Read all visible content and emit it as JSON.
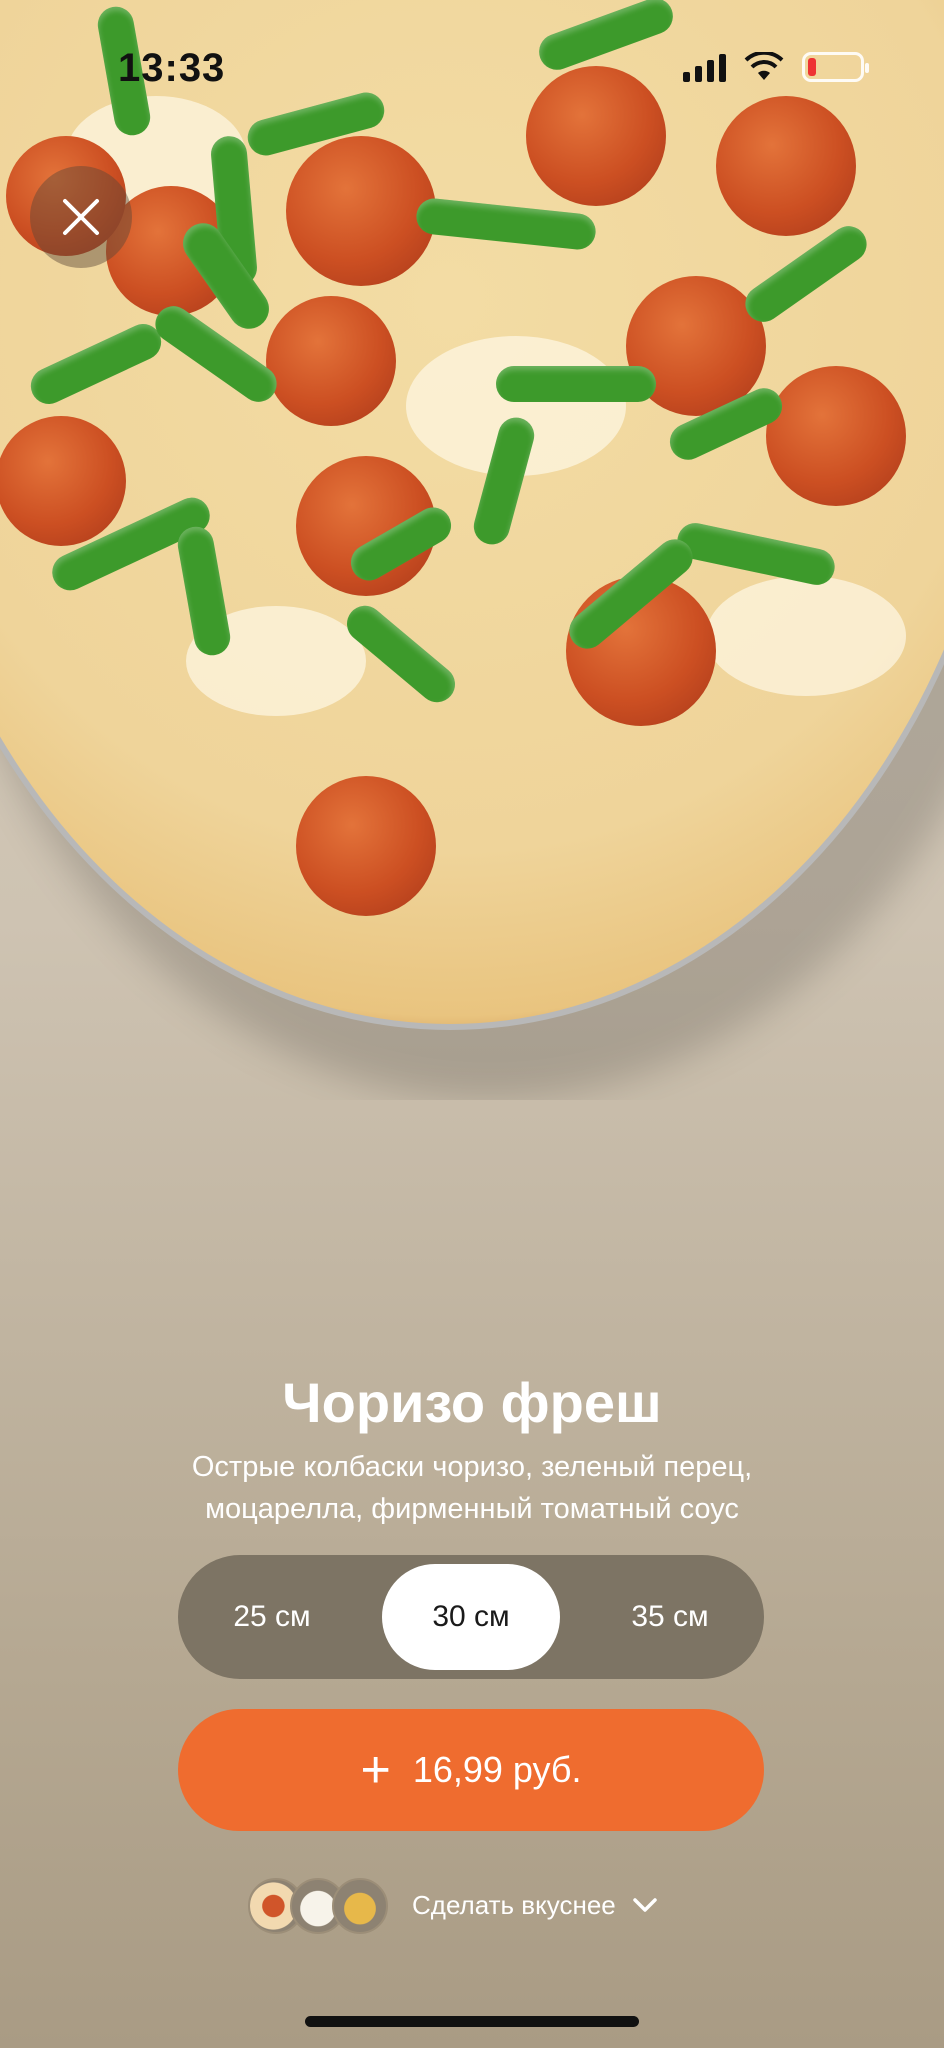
{
  "status_bar": {
    "time": "13:33"
  },
  "product": {
    "name": "Чоризо фреш",
    "description": "Острые колбаски чоризо, зеленый перец, моцарелла, фирменный томатный соус"
  },
  "sizes": [
    {
      "label": "25 см",
      "selected": false
    },
    {
      "label": "30 см",
      "selected": true
    },
    {
      "label": "35 см",
      "selected": false
    }
  ],
  "add_button": {
    "price": "16,99 руб."
  },
  "improve": {
    "label": "Сделать вкуснее"
  },
  "colors": {
    "accent": "#ef6c2f",
    "selector_bg": "#7d7464"
  },
  "icons": [
    "close-icon",
    "plus-icon",
    "chevron-down-icon",
    "wifi-icon",
    "battery-icon",
    "signal-icon"
  ]
}
